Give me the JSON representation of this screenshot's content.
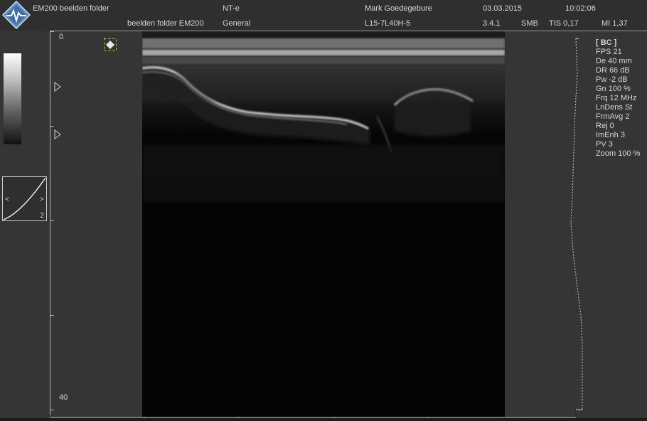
{
  "header": {
    "folder_name": "EM200 beelden folder",
    "folder_name_2": "beelden folder EM200",
    "preset": "NT-e",
    "application": "General",
    "operator": "Mark Goedegebure",
    "probe": "L15-7L40H-5",
    "date": "03.03.2015",
    "version": "3.4.1",
    "time": "10:02:06",
    "body_part": "SMB",
    "tis": "TIS 0,17",
    "mi": "MI 1,37"
  },
  "left_panel": {
    "curve_number": "2"
  },
  "depth_scale": {
    "top_label": "0",
    "bottom_label": "40"
  },
  "parameters": [
    "[ BC ]",
    "FPS 21",
    "De 40 mm",
    "DR 66 dB",
    "Pw -2 dB",
    "Gn 100 %",
    "Frq 12 MHz",
    "LnDens St",
    "FrmAvg 2",
    "Rej 0",
    "ImEnh 3",
    "PV 3",
    "Zoom 100 %"
  ],
  "colors": {
    "background": "#353535",
    "image_background": "#040404",
    "text": "#d6d6d6",
    "logo_blue": "#4a7fb5",
    "roi_yellow": "#d4d400"
  },
  "icons": {
    "logo": "diamond-heartbeat-logo",
    "roi": "roi-diamond-icon",
    "focus": "focus-triangle-icon"
  }
}
